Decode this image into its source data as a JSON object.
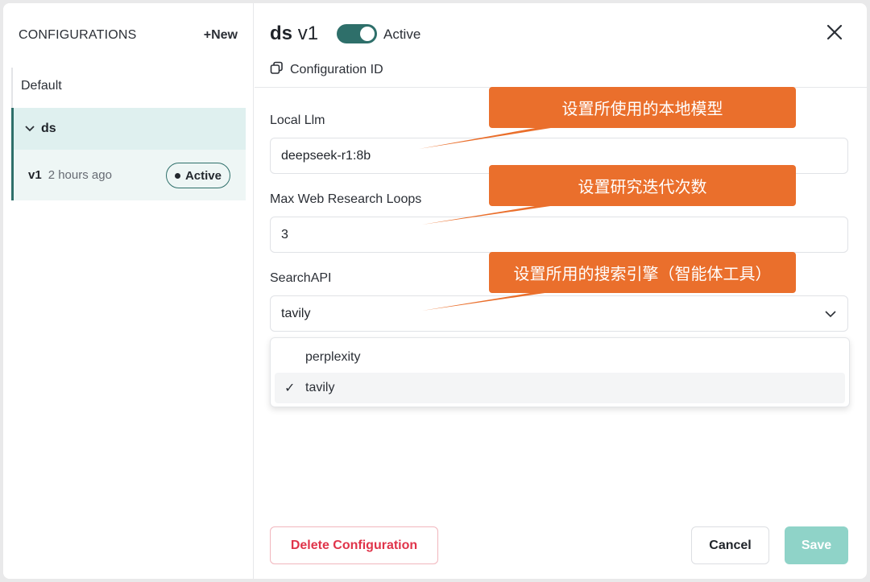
{
  "sidebar": {
    "title": "CONFIGURATIONS",
    "new_label": "+New",
    "items": [
      {
        "label": "Default"
      },
      {
        "label": "ds"
      }
    ],
    "version": {
      "label": "v1",
      "time": "2 hours ago",
      "badge": "Active"
    }
  },
  "main": {
    "title_name": "ds",
    "title_version": "v1",
    "toggle_label": "Active",
    "toggle_on": true,
    "config_id_label": "Configuration ID",
    "fields": {
      "local_llm": {
        "label": "Local Llm",
        "value": "deepseek-r1:8b"
      },
      "max_loops": {
        "label": "Max Web Research Loops",
        "value": "3"
      },
      "search_api": {
        "label": "SearchAPI",
        "value": "tavily",
        "options": [
          "perplexity",
          "tavily"
        ]
      }
    },
    "buttons": {
      "delete": "Delete Configuration",
      "cancel": "Cancel",
      "save": "Save"
    }
  },
  "annotations": [
    "设置所使用的本地模型",
    "设置研究迭代次数",
    "设置所用的搜索引擎（智能体工具）"
  ],
  "colors": {
    "accent": "#2e6f6a",
    "callout": "#ea6f2c",
    "danger": "#e0344a",
    "save_disabled": "#8fd3c8"
  }
}
